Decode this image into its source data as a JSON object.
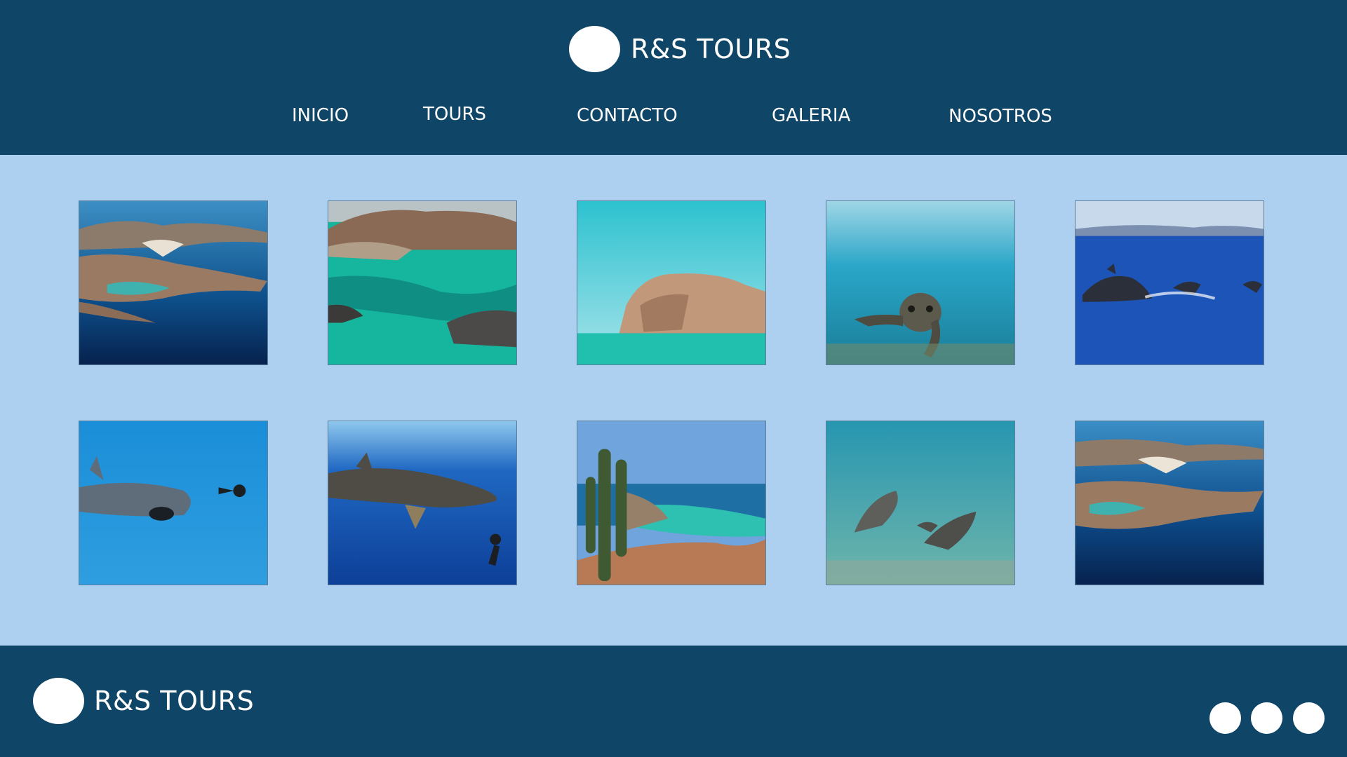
{
  "brand": {
    "name": "R&S TOURS"
  },
  "nav": {
    "items": [
      {
        "label": "INICIO"
      },
      {
        "label": "TOURS"
      },
      {
        "label": "CONTACTO"
      },
      {
        "label": "GALERIA"
      },
      {
        "label": "NOSOTROS"
      }
    ]
  },
  "gallery": {
    "photos": [
      {
        "subject": "aerial view of bay and islands"
      },
      {
        "subject": "turquoise lagoon with rocky shore"
      },
      {
        "subject": "rock island cliff in turquoise sea"
      },
      {
        "subject": "sea lion swimming underwater"
      },
      {
        "subject": "dolphins jumping in ocean"
      },
      {
        "subject": "whale shark and diver"
      },
      {
        "subject": "whale shark with diver underwater"
      },
      {
        "subject": "cactus overlooking beach"
      },
      {
        "subject": "sea lions swimming underwater"
      },
      {
        "subject": "aerial view of beach and lagoon"
      }
    ]
  },
  "footer": {
    "brand_name": "R&S TOURS",
    "social_icons": [
      "social-icon-1",
      "social-icon-2",
      "social-icon-3"
    ]
  },
  "colors": {
    "header_bg": "#0f4566",
    "page_bg": "#add0f1",
    "text": "#ffffff"
  }
}
